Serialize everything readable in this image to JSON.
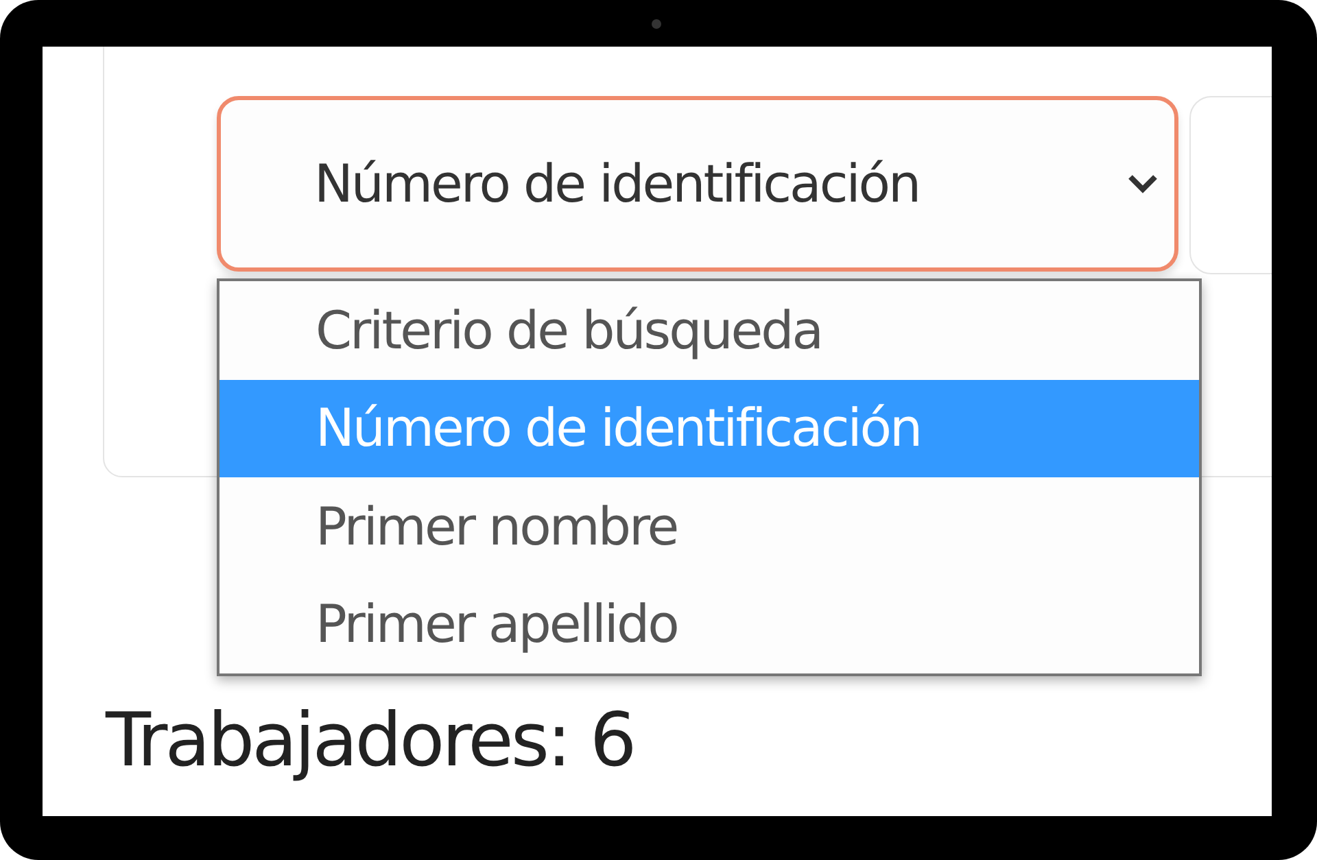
{
  "search_select": {
    "value": "Número de identificación",
    "options": [
      {
        "label": "Criterio de búsqueda",
        "selected": false
      },
      {
        "label": "Número de identificación",
        "selected": true
      },
      {
        "label": "Primer nombre",
        "selected": false
      },
      {
        "label": "Primer apellido",
        "selected": false
      }
    ]
  },
  "workers_count": "Trabajadores: 6"
}
